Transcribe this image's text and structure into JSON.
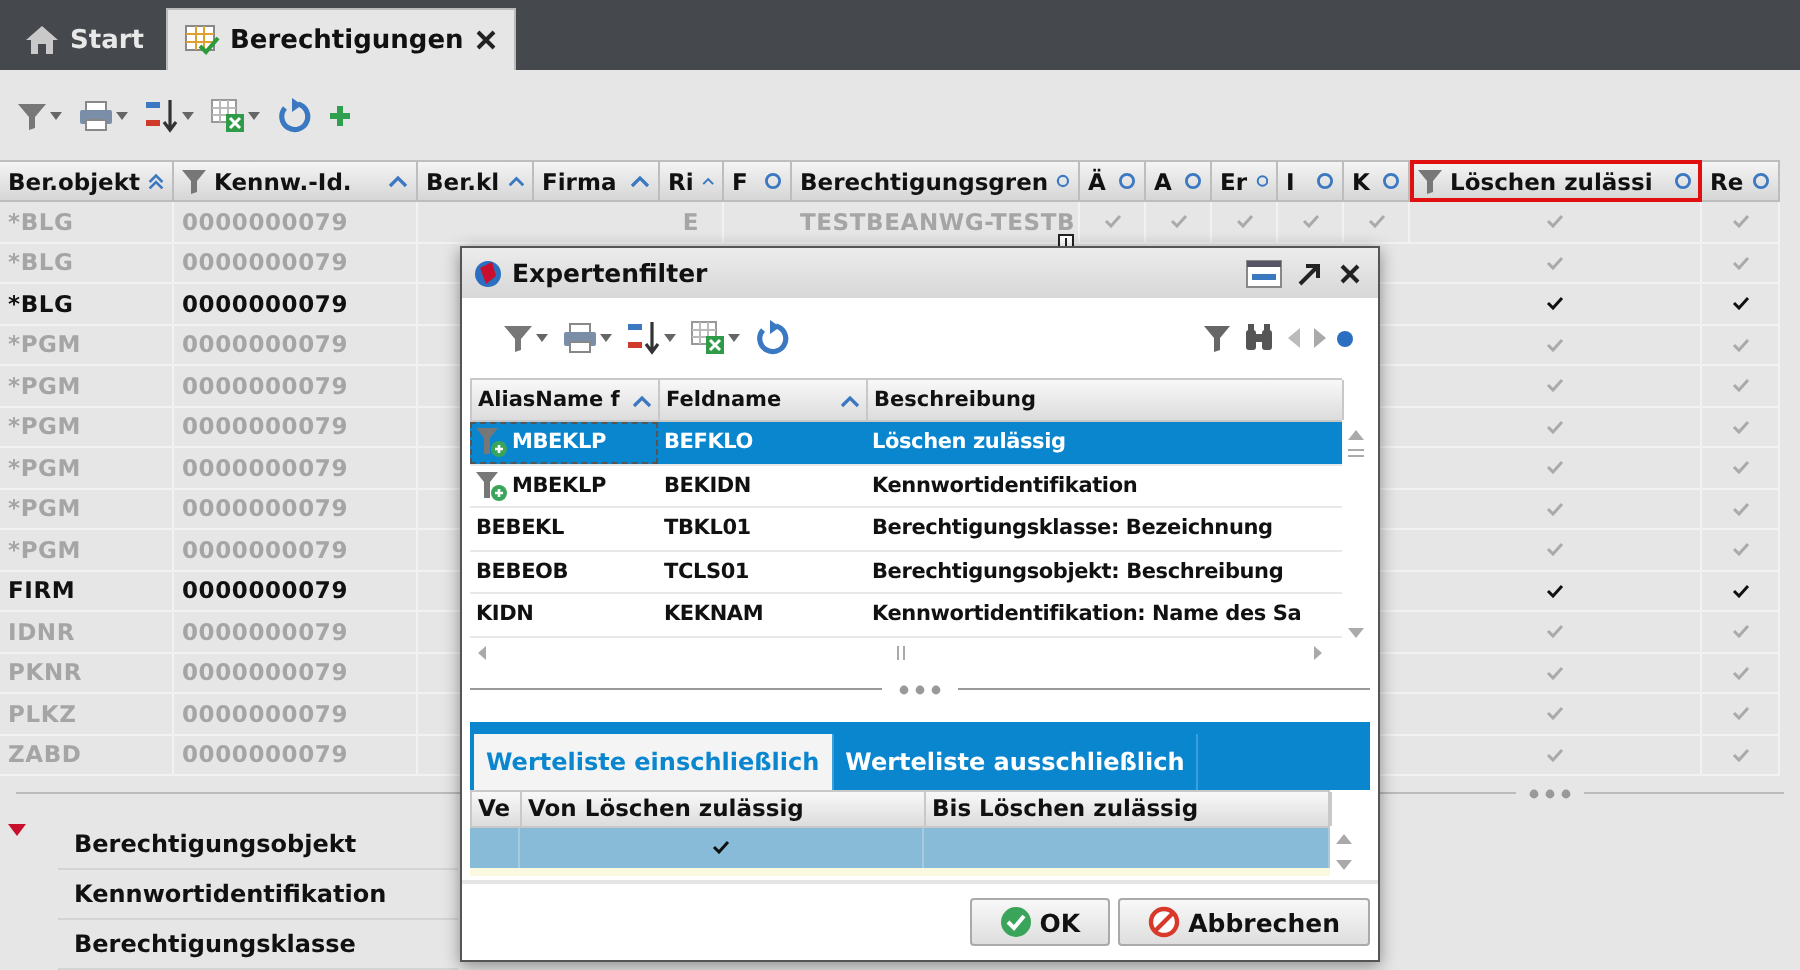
{
  "tabs": [
    {
      "label": "Start",
      "kind": "home",
      "selected": false,
      "closable": false
    },
    {
      "label": "Berechtigungen",
      "kind": "table",
      "selected": true,
      "closable": true
    }
  ],
  "table": {
    "columns": [
      {
        "label": "Ber.objekt",
        "kind": "double",
        "filtered": false,
        "highlighted": false
      },
      {
        "label": "Kennw.-Id.",
        "kind": "up",
        "filtered": true,
        "highlighted": false
      },
      {
        "label": "Ber.kl",
        "kind": "up",
        "filtered": false,
        "highlighted": false
      },
      {
        "label": "Firma",
        "kind": "up",
        "filtered": false,
        "highlighted": false
      },
      {
        "label": "Ri",
        "kind": "up",
        "filtered": false,
        "highlighted": false
      },
      {
        "label": "F",
        "kind": "none",
        "filtered": false,
        "highlighted": false
      },
      {
        "label": "Berechtigungsgren",
        "kind": "none",
        "filtered": false,
        "highlighted": false
      },
      {
        "label": "Ä",
        "kind": "none",
        "filtered": false,
        "highlighted": false
      },
      {
        "label": "A",
        "kind": "none",
        "filtered": false,
        "highlighted": false
      },
      {
        "label": "Er",
        "kind": "none",
        "filtered": false,
        "highlighted": false
      },
      {
        "label": "I",
        "kind": "none",
        "filtered": false,
        "highlighted": false
      },
      {
        "label": "K",
        "kind": "none",
        "filtered": false,
        "highlighted": false
      },
      {
        "label": "Löschen zulässi",
        "kind": "none",
        "filtered": true,
        "highlighted": true
      },
      {
        "label": "Re",
        "kind": "none",
        "filtered": false,
        "highlighted": false
      }
    ],
    "rows": [
      {
        "objekt": "*BLG",
        "kennw_id": "0000000079",
        "active": false,
        "ri": "E",
        "gruppe": "TESTBEANWG-TESTB",
        "flags": [
          true,
          true,
          true,
          true,
          true
        ],
        "loeschen": true,
        "re": true
      },
      {
        "objekt": "*BLG",
        "kennw_id": "0000000079",
        "active": false,
        "loeschen": true,
        "re": true
      },
      {
        "objekt": "*BLG",
        "kennw_id": "0000000079",
        "active": true,
        "loeschen": true,
        "re": true
      },
      {
        "objekt": "*PGM",
        "kennw_id": "0000000079",
        "active": false,
        "loeschen": true,
        "re": true
      },
      {
        "objekt": "*PGM",
        "kennw_id": "0000000079",
        "active": false,
        "loeschen": true,
        "re": true
      },
      {
        "objekt": "*PGM",
        "kennw_id": "0000000079",
        "active": false,
        "loeschen": true,
        "re": true
      },
      {
        "objekt": "*PGM",
        "kennw_id": "0000000079",
        "active": false,
        "loeschen": true,
        "re": true
      },
      {
        "objekt": "*PGM",
        "kennw_id": "0000000079",
        "active": false,
        "loeschen": true,
        "re": true
      },
      {
        "objekt": "*PGM",
        "kennw_id": "0000000079",
        "active": false,
        "loeschen": true,
        "re": true
      },
      {
        "objekt": "FIRM",
        "kennw_id": "0000000079",
        "active": true,
        "loeschen": true,
        "re": true
      },
      {
        "objekt": "IDNR",
        "kennw_id": "0000000079",
        "active": false,
        "loeschen": true,
        "re": true
      },
      {
        "objekt": "PKNR",
        "kennw_id": "0000000079",
        "active": false,
        "loeschen": true,
        "re": true
      },
      {
        "objekt": "PLKZ",
        "kennw_id": "0000000079",
        "active": false,
        "loeschen": true,
        "re": true
      },
      {
        "objekt": "ZABD",
        "kennw_id": "0000000079",
        "active": false,
        "loeschen": true,
        "re": true
      }
    ]
  },
  "detail_fields": [
    "Berechtigungsobjekt",
    "Kennwortidentifikation",
    "Berechtigungsklasse"
  ],
  "dialog": {
    "title": "Expertenfilter",
    "grid": {
      "columns": [
        {
          "label": "AliasName f",
          "kind": "up"
        },
        {
          "label": "Feldname",
          "kind": "up"
        },
        {
          "label": "Beschreibung",
          "kind": "none"
        }
      ],
      "rows": [
        {
          "alias": "MBEKLP",
          "feld": "BEFKLO",
          "beschreibung": "Löschen zulässig",
          "filtered": true,
          "selected": true
        },
        {
          "alias": "MBEKLP",
          "feld": "BEKIDN",
          "beschreibung": "Kennwortidentifikation",
          "filtered": true,
          "selected": false
        },
        {
          "alias": "BEBEKL",
          "feld": "TBKL01",
          "beschreibung": "Berechtigungsklasse: Bezeichnung",
          "filtered": false,
          "selected": false
        },
        {
          "alias": "BEBEOB",
          "feld": "TCLS01",
          "beschreibung": "Berechtigungsobjekt: Beschreibung",
          "filtered": false,
          "selected": false
        },
        {
          "alias": "KIDN",
          "feld": "KEKNAM",
          "beschreibung": "Kennwortidentifikation: Name des Sa",
          "filtered": false,
          "selected": false
        }
      ]
    },
    "value_tabs": [
      {
        "label": "Werteliste einschließlich",
        "selected": true
      },
      {
        "label": "Werteliste ausschließlich",
        "selected": false
      }
    ],
    "value_grid": {
      "columns": [
        "Ve",
        "Von Löschen zulässig",
        "Bis Löschen zulässig"
      ],
      "rows": [
        {
          "selected": true,
          "von_checked": true
        }
      ]
    },
    "buttons": [
      {
        "label": "OK",
        "kind": "ok"
      },
      {
        "label": "Abbrechen",
        "kind": "cancel"
      }
    ]
  }
}
